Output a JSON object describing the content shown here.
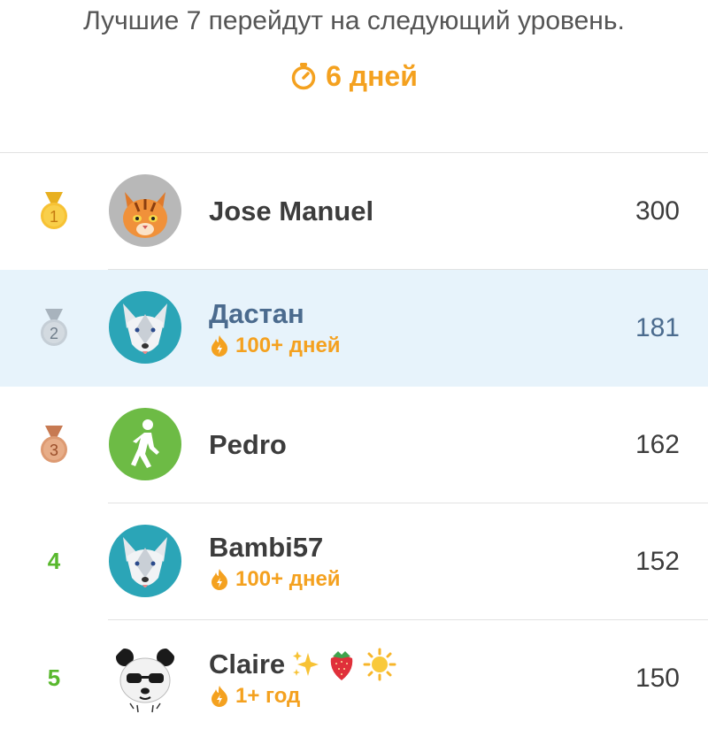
{
  "header": {
    "subtitle": "Лучшие 7 перейдут на следующий уровень.",
    "timer_text": "6 дней",
    "timer_icon": "stopwatch-icon",
    "accent_color": "#F4A11F"
  },
  "leaderboard": [
    {
      "rank": "1",
      "medal": "gold",
      "name": "Jose Manuel",
      "streak": "",
      "score": "300",
      "avatar": "tiger-avatar"
    },
    {
      "rank": "2",
      "medal": "silver",
      "name": "Дастан",
      "streak": "100+ дней",
      "score": "181",
      "avatar": "wolf-avatar",
      "highlight": true
    },
    {
      "rank": "3",
      "medal": "bronze",
      "name": "Pedro",
      "streak": "",
      "score": "162",
      "avatar": "walker-avatar"
    },
    {
      "rank": "4",
      "medal": "",
      "name": "Bambi57",
      "streak": "100+ дней",
      "score": "152",
      "avatar": "wolf-avatar"
    },
    {
      "rank": "5",
      "medal": "",
      "name": "Claire",
      "streak": "1+ год",
      "score": "150",
      "avatar": "panda-avatar",
      "emojis": [
        "sparkles-icon",
        "strawberry-icon",
        "sun-icon"
      ]
    }
  ]
}
